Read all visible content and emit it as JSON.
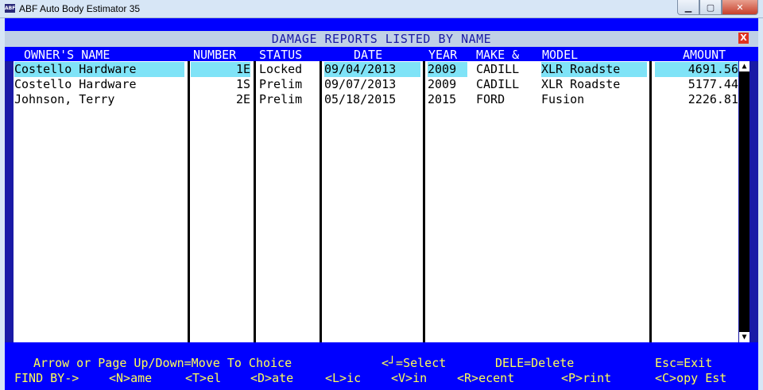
{
  "window": {
    "title": "ABF Auto Body Estimator 35",
    "icon_text": "ABF",
    "minimize": "▁",
    "maximize": "▢",
    "close": "✕"
  },
  "panel": {
    "title": "DAMAGE REPORTS LISTED BY NAME",
    "close_label": "X"
  },
  "columns": {
    "owner": "OWNER'S NAME",
    "number": "NUMBER",
    "status": "STATUS",
    "date": "DATE",
    "year": "YEAR",
    "make": "MAKE &",
    "model": "MODEL",
    "amount": "AMOUNT"
  },
  "rows": [
    {
      "owner": "Costello Hardware",
      "number": "1E",
      "status": "Locked",
      "date": "09/04/2013",
      "year": "2009",
      "make": "CADILL",
      "model": "XLR Roadste",
      "amount": "4691.56"
    },
    {
      "owner": "Costello Hardware",
      "number": "1S",
      "status": "Prelim",
      "date": "09/07/2013",
      "year": "2009",
      "make": "CADILL",
      "model": "XLR Roadste",
      "amount": "5177.44"
    },
    {
      "owner": "Johnson, Terry",
      "number": "2E",
      "status": "Prelim",
      "date": "05/18/2015",
      "year": "2015",
      "make": "FORD",
      "model": "Fusion",
      "amount": "2226.81"
    }
  ],
  "scroll": {
    "up": "▲",
    "down": "▼"
  },
  "help": {
    "line1": {
      "move": "Arrow or Page Up/Down=Move To Choice",
      "select": "<┘=Select",
      "delete": "DELE=Delete",
      "exit": "Esc=Exit"
    },
    "line2": {
      "findby": "FIND BY->",
      "name": "<N>ame",
      "tel": "<T>el",
      "date": "<D>ate",
      "lic": "<L>ic",
      "vin": "<V>in",
      "recent": "<R>ecent",
      "print": "<P>rint",
      "copy": "<C>opy Est"
    }
  },
  "colors": {
    "background": "#1a1aa6",
    "header_blue": "#0000ff",
    "highlight": "#7fe3f7",
    "help_text": "#ffff55"
  }
}
